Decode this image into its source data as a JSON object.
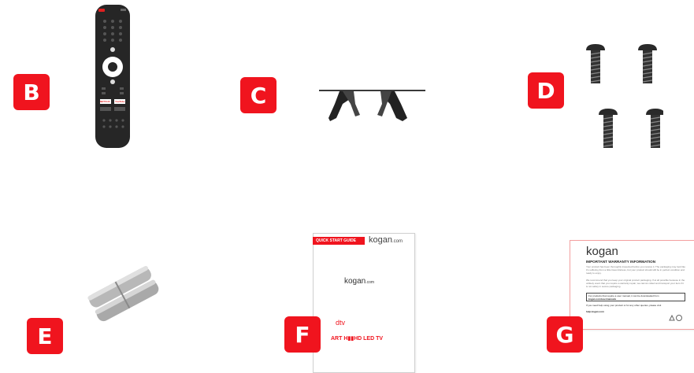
{
  "badges": {
    "b": "B",
    "c": "C",
    "d": "D",
    "e": "E",
    "f": "F",
    "g": "G"
  },
  "brand_color": "#f0141e",
  "remote": {
    "netflix": "NETFLIX",
    "youtube": "YouTube"
  },
  "quick_start": {
    "header_label": "QUICK START GUIDE",
    "brand": "kogan",
    "brand_suffix": ".com",
    "center_brand": "kogan",
    "center_suffix": ".com",
    "product_fragment": "dtv",
    "product_title": "ART H▮▮HD LED TV"
  },
  "warranty": {
    "brand": "kogan",
    "title": "IMPORTANT WARRANTY INFORMATION",
    "para1": "Your product has been thoroughly inspected before you receive it. The packaging may look like it's suffering from a little travel distress, but your product should still be in perfect condition and ready to enjoy.",
    "para2": "We recommend that you keep your original product packaging. If at all possible because in the unlikely event that you require a warranty repair, we cannot collect and transport your item if it is not safely in secure packaging.",
    "box_text": "For products that require a user manual, it can be downloaded from",
    "box_link": "kogan.com/usermanuals",
    "help_text": "If you need help using your product or for any other queries, please visit",
    "help_link": "help.kogan.com"
  }
}
